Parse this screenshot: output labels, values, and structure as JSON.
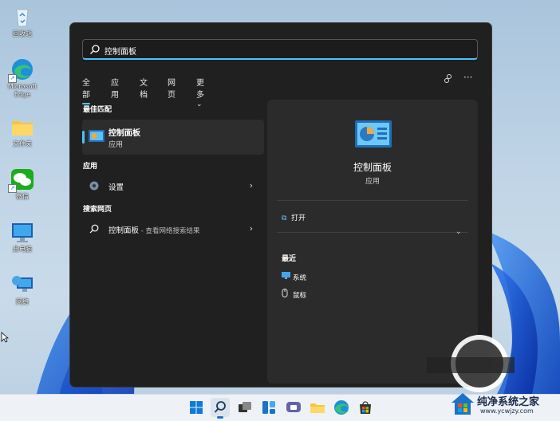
{
  "desktop": {
    "icons": [
      {
        "name": "recycle-bin",
        "label": "回收站"
      },
      {
        "name": "edge",
        "label": "Microsoft Edge"
      },
      {
        "name": "folder",
        "label": "文件夹"
      },
      {
        "name": "wechat",
        "label": "微信"
      },
      {
        "name": "this-pc",
        "label": "此电脑"
      },
      {
        "name": "network",
        "label": "网络"
      }
    ]
  },
  "search": {
    "query": "控制面板"
  },
  "tabs": [
    "全部",
    "应用",
    "文档",
    "网页",
    "更多"
  ],
  "more_chevron": "⌄",
  "left": {
    "best_match_header": "最佳匹配",
    "best_match": {
      "title": "控制面板",
      "subtitle": "应用"
    },
    "apps_header": "应用",
    "apps": [
      {
        "label": "设置"
      }
    ],
    "web_header": "搜索网页",
    "web": [
      {
        "label": "控制面板",
        "sub": " - 查看网络搜索结果"
      }
    ]
  },
  "right": {
    "title": "控制面板",
    "subtitle": "应用",
    "open_label": "打开",
    "recent_header": "最近",
    "recent": [
      {
        "label": "系统"
      },
      {
        "label": "鼠标"
      }
    ]
  },
  "watermark": {
    "title": "纯净系统之家",
    "url": "www.ycwjzy.com"
  },
  "colors": {
    "accent": "#4cc2ff",
    "panel": "#202020",
    "taskbar": "#eef2f7"
  }
}
